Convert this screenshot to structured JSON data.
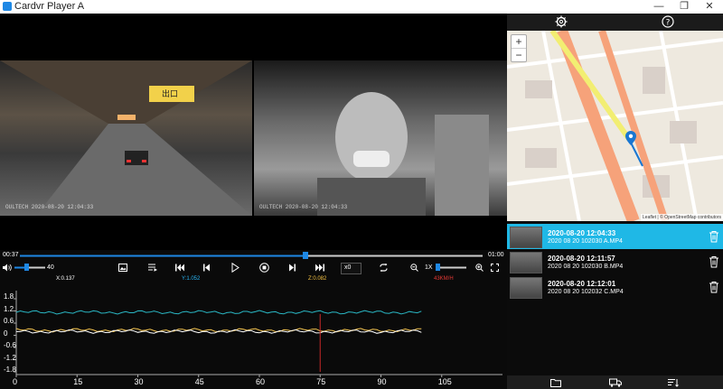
{
  "window": {
    "title": "Cardvr Player A",
    "controls": {
      "minimize": "—",
      "maximize": "❐",
      "close": "✕"
    }
  },
  "video": {
    "front_stamp": "OULTECH 2020-08-20 12:04:33",
    "inside_stamp": "OULTECH 2020-08-20 12:04:33",
    "front_sign": "出口",
    "colors": {
      "sign_bg": "#f2d14a",
      "tunnel_light": "#f4b26a"
    }
  },
  "playback": {
    "current_time": "00:37",
    "end_time": "01:00",
    "progress": 0.617,
    "volume": "40",
    "volume_fraction": 0.4,
    "speed_multiplier": "x0",
    "speed": "1X",
    "speed_fraction": 0.1
  },
  "readout": {
    "x": "X:0.137",
    "y": "Y:1.052",
    "z": "Z:0.082",
    "speed": "43KM/H",
    "colors": {
      "x": "#ffffff",
      "y": "#29b6f6",
      "z": "#f5c242",
      "speed": "#e53935"
    }
  },
  "graph": {
    "y_ticks": [
      "1.8",
      "1.2",
      "0.6",
      "0",
      "-0.6",
      "-1.2",
      "-1.8"
    ],
    "x_ticks": [
      "0",
      "15",
      "30",
      "45",
      "60",
      "75",
      "90",
      "105"
    ],
    "marker_x": 75,
    "x_max": 120,
    "y_range": [
      -1.8,
      1.8
    ],
    "series_colors": [
      "#2ab7c4",
      "#f4c44f",
      "#ffffff"
    ]
  },
  "map": {
    "zoom_in": "+",
    "zoom_out": "−",
    "attribution": "Leaflet | © OpenStreetMap contributors",
    "road_color": "#f6a27a",
    "route_color": "#f2ee72",
    "marker_color": "#1976d2"
  },
  "files": [
    {
      "time": "2020-08-20 12:04:33",
      "name": "2020 08 20 102030 A.MP4",
      "active": true
    },
    {
      "time": "2020-08-20 12:11:57",
      "name": "2020 08 20 102030 B.MP4",
      "active": false
    },
    {
      "time": "2020-08-20 12:12:01",
      "name": "2020 08 20 102032 C.MP4",
      "active": false
    }
  ],
  "icons": {
    "settings": "gear-icon",
    "help": "help-icon",
    "open_folder": "folder-icon",
    "export": "truck-icon",
    "sort": "sort-icon"
  }
}
